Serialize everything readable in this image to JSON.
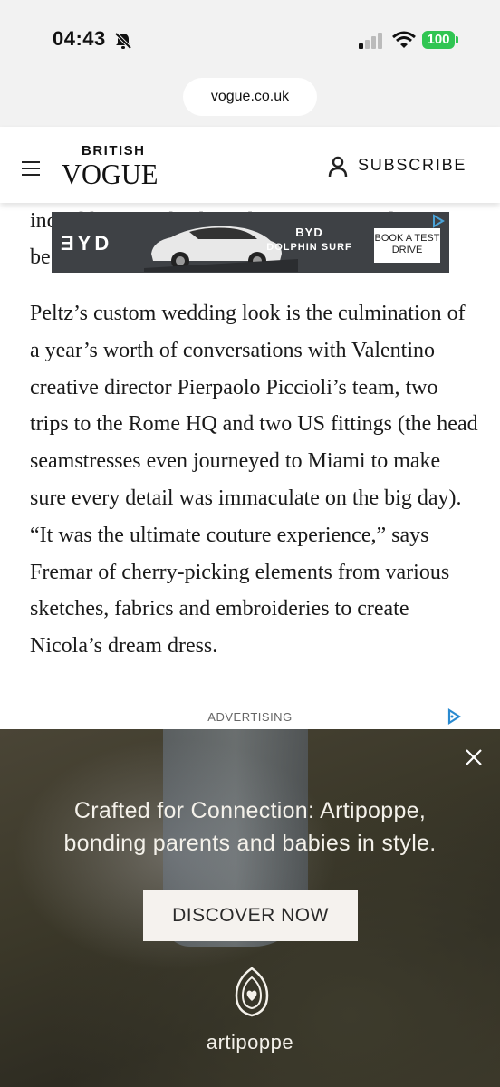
{
  "status_bar": {
    "time": "04:43",
    "battery": "100"
  },
  "browser": {
    "url": "vogue.co.uk"
  },
  "site_header": {
    "logo_small": "BRITISH",
    "logo_big": "VOGUE",
    "subscribe_label": "SUBSCRIBE"
  },
  "top_ad": {
    "logo": "ƎYD",
    "brand": "BYD",
    "model": "DOLPHIN SURF",
    "cta": "BOOK A TEST DRIVE"
  },
  "article": {
    "cut_line_1": "incredible,” the bride told British Vogue days",
    "cut_line_2": "be",
    "paragraph": "Peltz’s custom wedding look is the culmination of a year’s worth of conversations with Valentino creative director Pierpaolo Piccioli’s team, two trips to the Rome HQ and two US fittings (the head seamstresses even journeyed to Miami to make sure every detail was immaculate on the big day). “It was the ultimate couture experience,” says Fremar of cherry-picking elements from various sketches, fabrics and embroideries to create Nicola’s dream dress."
  },
  "advertising_label": "ADVERTISING",
  "bottom_ad": {
    "headline_line1": "Crafted for Connection: Artipoppe,",
    "headline_line2": "bonding parents and babies in style.",
    "button": "DISCOVER NOW",
    "brand": "artipoppe"
  }
}
